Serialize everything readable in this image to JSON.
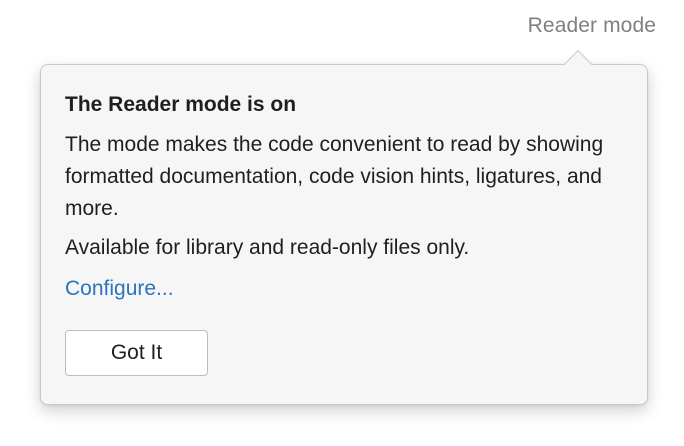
{
  "header": {
    "reader_mode_label": "Reader mode"
  },
  "popup": {
    "title": "The Reader mode is on",
    "description": "The mode makes the code convenient to read by showing formatted documentation, code vision hints, ligatures, and more.",
    "availability": "Available for library and read-only files only.",
    "configure_link": "Configure...",
    "got_it_label": "Got It"
  },
  "colors": {
    "link": "#2a75bd",
    "muted_text": "#808080",
    "popup_background": "#f6f6f6"
  }
}
